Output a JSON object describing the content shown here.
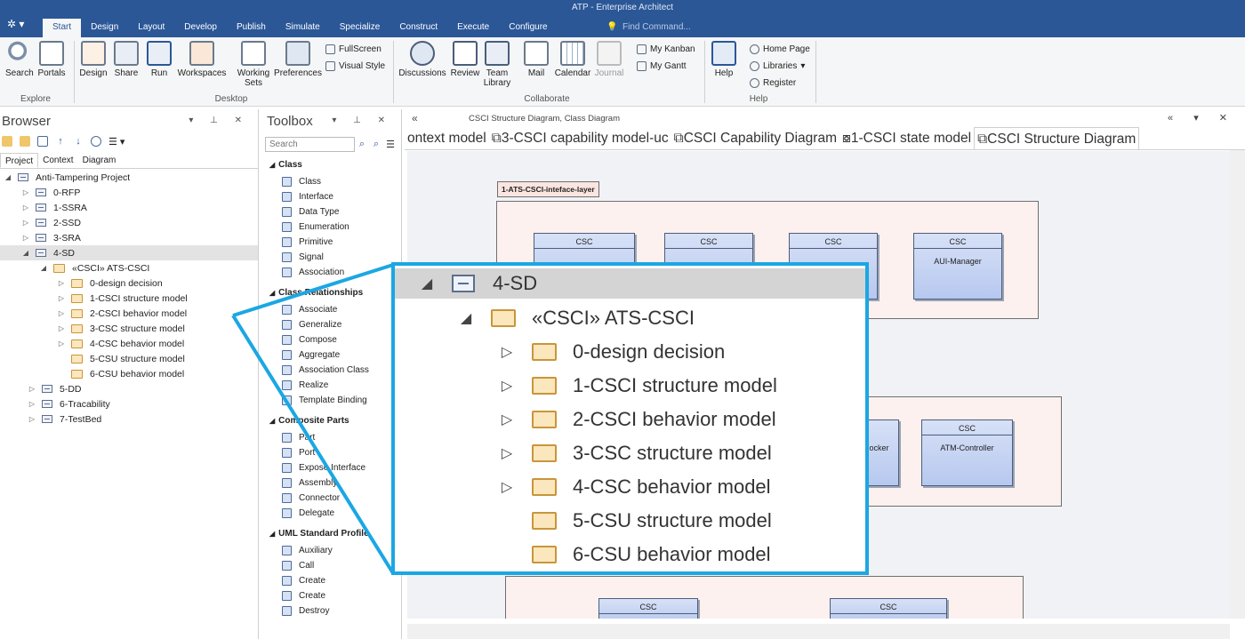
{
  "window": {
    "title": "ATP - Enterprise Architect"
  },
  "ribbon": {
    "tabs": [
      "Start",
      "Design",
      "Layout",
      "Develop",
      "Publish",
      "Simulate",
      "Specialize",
      "Construct",
      "Execute",
      "Configure"
    ],
    "find_placeholder": "Find Command...",
    "buttons": {
      "search": "Search",
      "portals": "Portals",
      "design": "Design",
      "share": "Share",
      "run": "Run",
      "workspaces": "Workspaces",
      "working_sets": "Working Sets",
      "preferences": "Preferences",
      "fullscreen": "FullScreen",
      "visual_style": "Visual Style",
      "discussions": "Discussions",
      "review": "Review",
      "team_library": "Team Library",
      "mail": "Mail",
      "calendar": "Calendar",
      "journal": "Journal",
      "my_kanban": "My Kanban",
      "my_gantt": "My Gantt",
      "help": "Help",
      "home_page": "Home Page",
      "libraries": "Libraries",
      "register": "Register"
    },
    "groups": {
      "explore": "Explore",
      "desktop": "Desktop",
      "collaborate": "Collaborate",
      "help": "Help"
    }
  },
  "browser": {
    "title": "Browser",
    "tabs": [
      "Project",
      "Context",
      "Diagram"
    ],
    "root": "Anti-Tampering Project",
    "items": [
      "0-RFP",
      "1-SSRA",
      "2-SSD",
      "3-SRA",
      "4-SD"
    ],
    "csci": "«CSCI» ATS-CSCI",
    "csci_children": [
      "0-design decision",
      "1-CSCI structure model",
      "2-CSCI behavior model",
      "3-CSC structure model",
      "4-CSC behavior model",
      "5-CSU structure model",
      "6-CSU behavior model"
    ],
    "after": [
      "5-DD",
      "6-Tracability",
      "7-TestBed"
    ]
  },
  "toolbox": {
    "title": "Toolbox",
    "search_placeholder": "Search",
    "groups": [
      {
        "name": "Class",
        "items": [
          "Class",
          "Interface",
          "Data Type",
          "Enumeration",
          "Primitive",
          "Signal",
          "Association"
        ]
      },
      {
        "name": "Class Relationships",
        "items": [
          "Associate",
          "Generalize",
          "Compose",
          "Aggregate",
          "Association Class",
          "Realize",
          "Template Binding"
        ]
      },
      {
        "name": "Composite Parts",
        "items": [
          "Part",
          "Port",
          "Expose Interface",
          "Assembly",
          "Connector",
          "Delegate"
        ]
      },
      {
        "name": "UML Standard Profile",
        "items": [
          "Auxiliary",
          "Call",
          "Create",
          "Create",
          "Destroy"
        ]
      }
    ]
  },
  "diagram": {
    "breadcrumb": "CSCI Structure Diagram,  Class Diagram",
    "tabs": [
      "ontext model",
      "3-CSCI capability model-uc",
      "CSCI Capability Diagram",
      "1-CSCI state model",
      "CSCI Structure Diagram"
    ],
    "package_label": "1-ATS-CSCI-inteface-layer",
    "stereotype": "CSC",
    "class_names": {
      "aui": "AUI-Manager",
      "blocker": "locker",
      "atm": "ATM-Controller"
    }
  },
  "zoom": {
    "item": "4-SD",
    "csci": "«CSCI» ATS-CSCI",
    "children": [
      "0-design decision",
      "1-CSCI structure model",
      "2-CSCI behavior model",
      "3-CSC structure model",
      "4-CSC behavior model",
      "5-CSU structure model",
      "6-CSU behavior model"
    ]
  },
  "colors": {
    "titlebar": "#2b5797",
    "callout": "#1ba7e3",
    "selection": "#e3e3e3"
  }
}
